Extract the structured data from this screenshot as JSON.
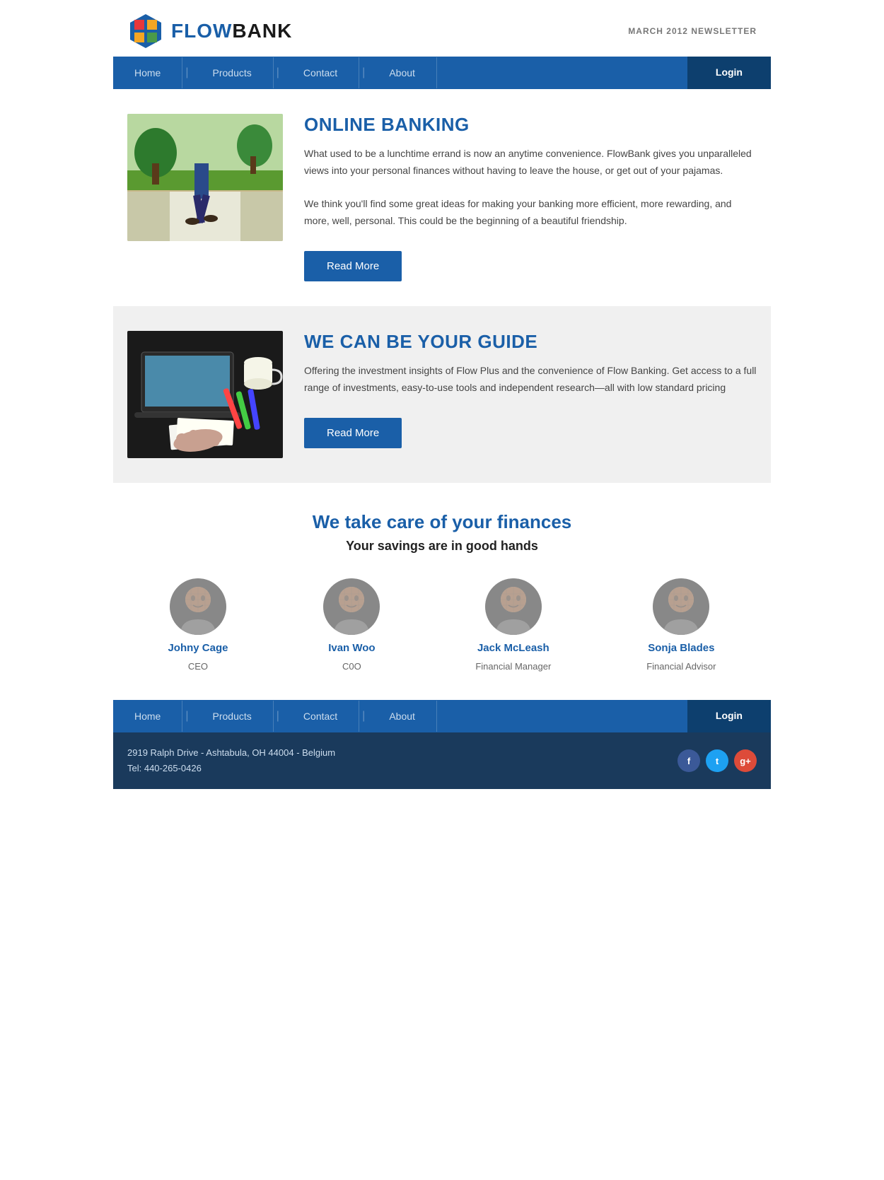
{
  "header": {
    "logo_bold": "FLOW",
    "logo_regular": "BANK",
    "newsletter_month": "MARCH 2012",
    "newsletter_label": "NEWSLETTER"
  },
  "navbar": {
    "items": [
      {
        "label": "Home",
        "id": "home"
      },
      {
        "label": "Products",
        "id": "products"
      },
      {
        "label": "Contact",
        "id": "contact"
      },
      {
        "label": "About",
        "id": "about"
      }
    ],
    "login_label": "Login"
  },
  "section1": {
    "title": "ONLINE BANKING",
    "body1": "What used to be a lunchtime errand is now an anytime convenience. FlowBank gives you unparalleled views into your personal finances without having to leave the house, or get out of your pajamas.",
    "body2": "We think you'll find some great ideas for making your banking more efficient, more rewarding, and more, well, personal. This could be the beginning of a beautiful friendship.",
    "button_label": "Read More"
  },
  "section2": {
    "title": "WE CAN BE YOUR GUIDE",
    "body": "Offering the investment insights of Flow Plus and the convenience of Flow Banking. Get access to a full range of investments, easy-to-use tools and independent research—all with low standard pricing",
    "button_label": "Read More"
  },
  "team": {
    "headline": "We take care of your finances",
    "subheadline": "Your savings are in good hands",
    "members": [
      {
        "name": "Johny Cage",
        "role": "CEO"
      },
      {
        "name": "Ivan Woo",
        "role": "C0O"
      },
      {
        "name": "Jack McLeash",
        "role": "Financial Manager"
      },
      {
        "name": "Sonja Blades",
        "role": "Financial Advisor"
      }
    ]
  },
  "footer": {
    "nav_items": [
      {
        "label": "Home"
      },
      {
        "label": "Products"
      },
      {
        "label": "Contact"
      },
      {
        "label": "About"
      }
    ],
    "login_label": "Login",
    "address_line1": "2919 Ralph Drive - Ashtabula, OH 44004 - Belgium",
    "address_line2": "Tel: 440-265-0426",
    "social": {
      "facebook": "f",
      "twitter": "t",
      "googleplus": "g+"
    }
  }
}
